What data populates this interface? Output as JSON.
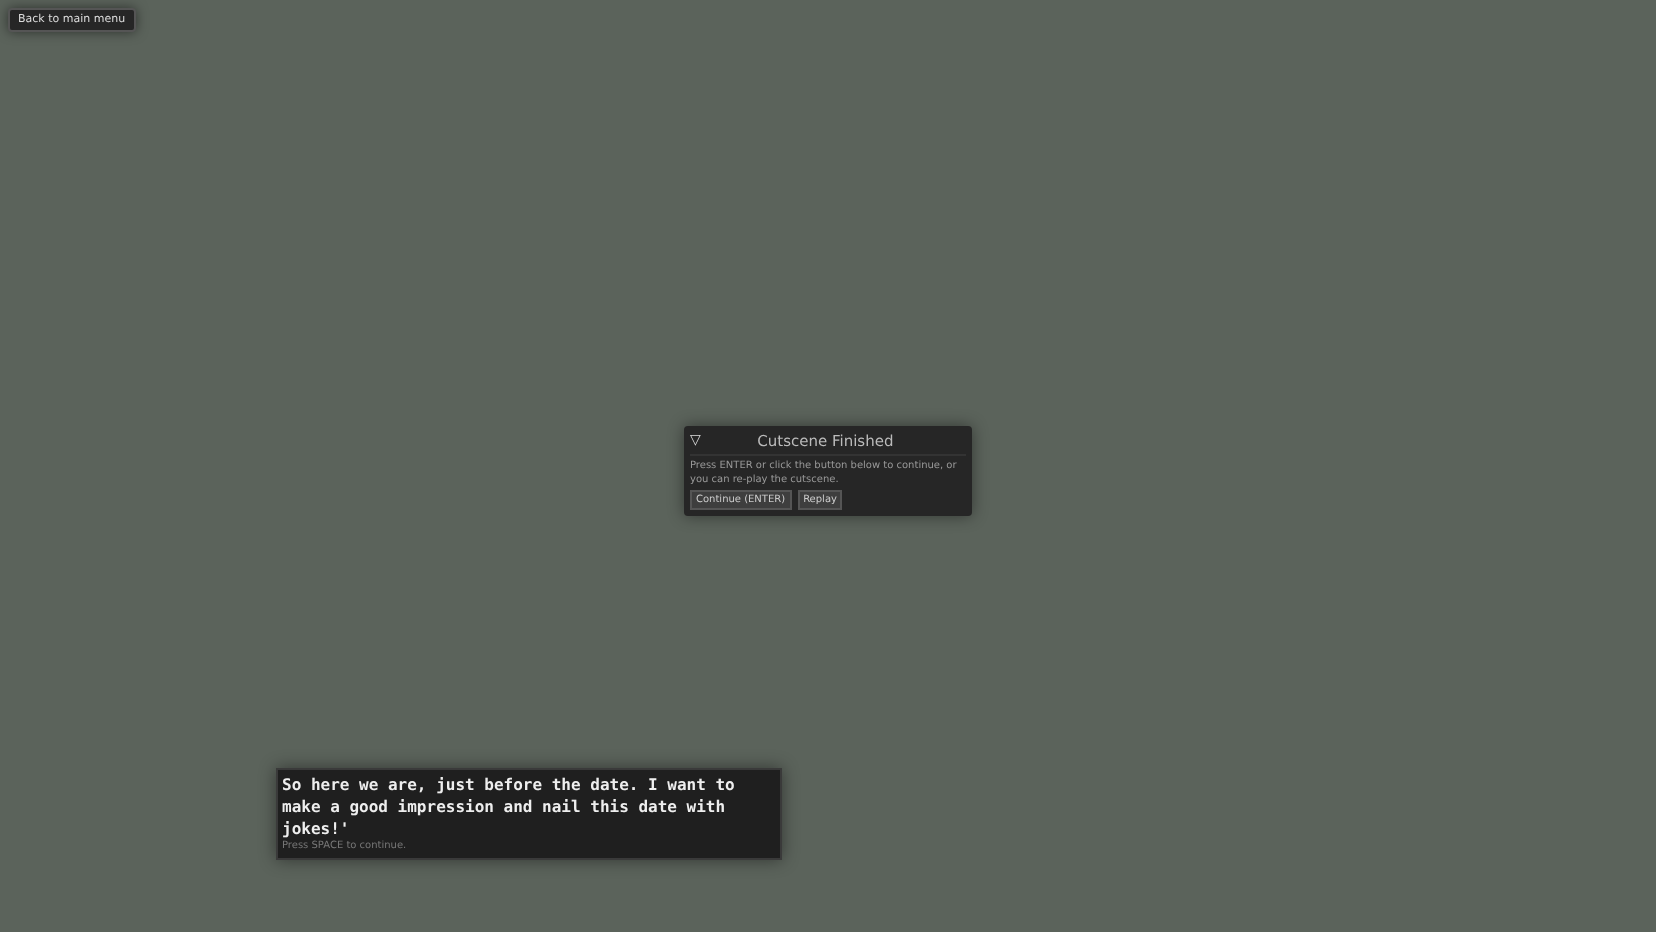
{
  "back_button": {
    "label": "Back to main menu"
  },
  "dialog": {
    "collapse_glyph": "▽",
    "title": "Cutscene Finished",
    "message": "Press ENTER or click the button below to continue, or you can re-play the cutscene.",
    "buttons": [
      {
        "label": "Continue (ENTER)"
      },
      {
        "label": "Replay"
      }
    ]
  },
  "subtitle": {
    "text": "So here we are, just before the date. I want to make a good impression and nail this date with jokes!'",
    "hint": "Press SPACE to continue."
  }
}
